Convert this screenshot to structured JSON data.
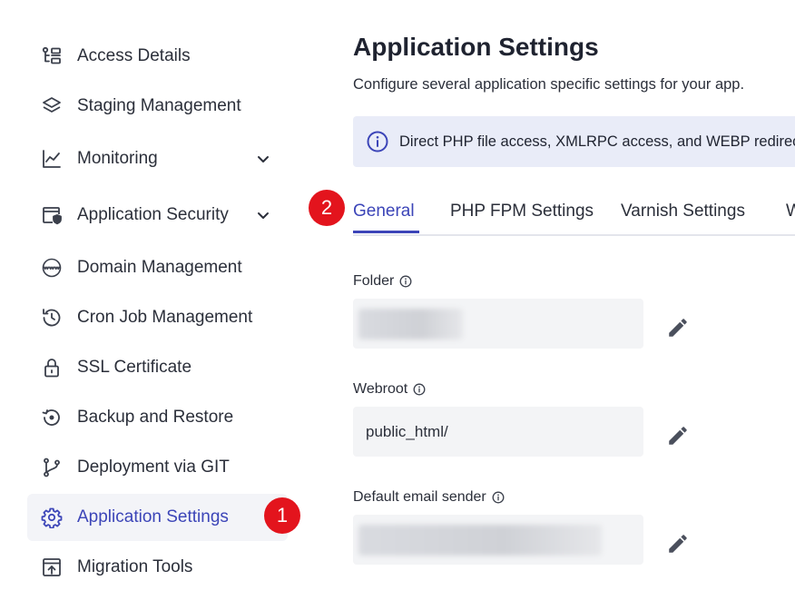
{
  "sidebar": {
    "items": [
      {
        "label": "Access Details",
        "icon": "access-details-icon"
      },
      {
        "label": "Staging Management",
        "icon": "layers-icon"
      },
      {
        "label": "Monitoring",
        "icon": "chart-line-icon",
        "expandable": true
      },
      {
        "label": "Application Security",
        "icon": "shield-browser-icon",
        "expandable": true
      },
      {
        "label": "Domain Management",
        "icon": "www-globe-icon"
      },
      {
        "label": "Cron Job Management",
        "icon": "history-clock-icon"
      },
      {
        "label": "SSL Certificate",
        "icon": "lock-icon"
      },
      {
        "label": "Backup and Restore",
        "icon": "restore-icon"
      },
      {
        "label": "Deployment via GIT",
        "icon": "git-branch-icon"
      },
      {
        "label": "Application Settings",
        "icon": "gear-icon",
        "active": true
      },
      {
        "label": "Migration Tools",
        "icon": "migration-icon"
      }
    ]
  },
  "markers": {
    "one": "1",
    "two": "2"
  },
  "main": {
    "title": "Application Settings",
    "subtitle": "Configure several application specific settings for your app.",
    "banner": {
      "text": "Direct PHP file access, XMLRPC access, and WEBP redirection settings are available"
    },
    "tabs": [
      {
        "label": "General",
        "active": true
      },
      {
        "label": "PHP FPM Settings"
      },
      {
        "label": "Varnish Settings"
      },
      {
        "label": "W"
      }
    ],
    "fields": {
      "folder": {
        "label": "Folder",
        "value": ""
      },
      "webroot": {
        "label": "Webroot",
        "value": "public_html/"
      },
      "email": {
        "label": "Default email sender",
        "value": ""
      }
    }
  },
  "colors": {
    "accent": "#3c45b8",
    "marker": "#e3141d",
    "banner_bg": "#e9ecf8",
    "field_bg": "#f3f4f6"
  }
}
